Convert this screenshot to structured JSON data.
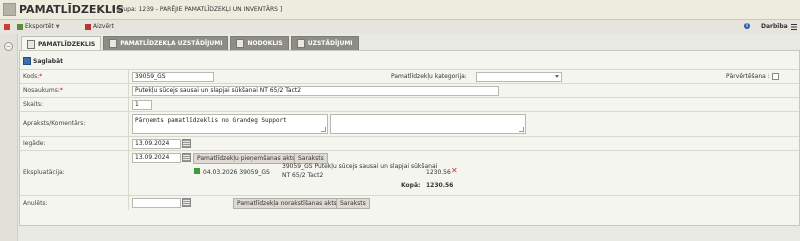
{
  "app": {
    "title": "PAMATLĪDZEKLIS",
    "subtitle": "[ Grupa: 1239 - PARĒJIE PAMATLĪDZEKĻI UN INVENTĀRS ]"
  },
  "toolbar": {
    "export_label": "Eksportēt",
    "close_label": "Aizvērt",
    "actions_label": "Darbība",
    "info_icon": "i"
  },
  "tabs": [
    {
      "label": "PAMATLĪDZEKLIS",
      "active": true
    },
    {
      "label": "PAMATLĪDZEKĻA UZSTĀDĪJUMI",
      "active": false
    },
    {
      "label": "NODOKLIS",
      "active": false
    },
    {
      "label": "UZSTĀDĪJUMI",
      "active": false
    }
  ],
  "form": {
    "save_label": "Saglabāt",
    "kods": {
      "label": "Kods:",
      "value": "39059_GS"
    },
    "kategorija": {
      "label": "Pamatlīdzekļu kategorija:",
      "value": ""
    },
    "parvertesana": {
      "label": "Pārvērtēšana :",
      "checked": false
    },
    "nosaukums": {
      "label": "Nosaukums:",
      "value": "Putekļu sūcejs sausai un slapjai sūkšanai NT 65/2 Tact2"
    },
    "skaits": {
      "label": "Skaits:",
      "value": "1"
    },
    "apraksts": {
      "label": "Apraksts/Komentārs:",
      "value": "Pārņemts pamatlīdzeklis no Grandeg Support",
      "value2": ""
    },
    "iegade": {
      "label": "Iegāde:",
      "value": "13.09.2024"
    },
    "ekspluatacija": {
      "label": "Ekspluatācija:",
      "date": "13.09.2024",
      "act_button": "Pamatlīdzekļu pieņemšanas akts",
      "list_button": "Saraksts",
      "entry": {
        "date_code": "04.03.2026 39059_GS",
        "name_line1": "39059_GS Putekļu sūcejs sausai un slapjai sūkšanai",
        "name_line2": "NT 65/2 Tact2",
        "amount": "1230.56"
      },
      "total_label": "Kopā:",
      "total": "1230.56"
    },
    "anulets": {
      "label": "Anulēts:",
      "value": "",
      "act_button": "Pamatlīdzekļa norakstīšanas akts",
      "list_button": "Saraksts"
    }
  }
}
